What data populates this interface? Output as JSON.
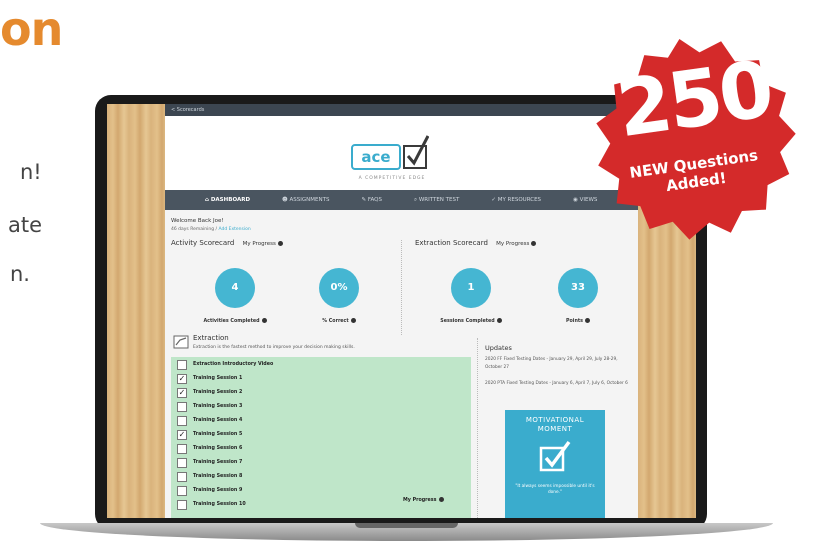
{
  "marketing": {
    "title": "on",
    "line1": "n!",
    "line2": "ate",
    "line3": "n."
  },
  "colors": {
    "accent": "#3aaccd",
    "orange": "#e58a2e",
    "seal_red": "#d42a2a",
    "green_panel": "#bfe6c9"
  },
  "app": {
    "topbar": "< Scorecards",
    "logo": {
      "text": "ace",
      "subtitle": "A COMPETITIVE EDGE"
    },
    "nav": [
      {
        "label": "DASHBOARD",
        "icon": "home-icon",
        "active": true
      },
      {
        "label": "ASSIGNMENTS",
        "icon": "users-icon",
        "active": false
      },
      {
        "label": "FAQS",
        "icon": "question-icon",
        "active": false
      },
      {
        "label": "WRITTEN TEST",
        "icon": "search-icon",
        "active": false
      },
      {
        "label": "MY RESOURCES",
        "icon": "check-icon",
        "active": false
      },
      {
        "label": "VIEWS",
        "icon": "eye-icon",
        "active": false
      }
    ],
    "welcome": "Welcome Back Joe!",
    "subinfo_text": "46 days Remaining",
    "subinfo_link": "Add Extension",
    "activity": {
      "title": "Activity Scorecard",
      "progress": "My Progress",
      "stats": [
        {
          "value": "4",
          "label": "Activities Completed"
        },
        {
          "value": "0%",
          "label": "% Correct"
        }
      ]
    },
    "extraction_card": {
      "title": "Extraction Scorecard",
      "progress": "My Progress",
      "stats": [
        {
          "value": "1",
          "label": "Sessions Completed"
        },
        {
          "value": "33",
          "label": "Points"
        }
      ]
    },
    "extraction": {
      "title": "Extraction",
      "description": "Extraction is the fastest method to improve your decision making skills.",
      "my_progress": "My Progress",
      "tasks": [
        {
          "label": "Extraction Introductory Video",
          "checked": false
        },
        {
          "label": "Training Session 1",
          "checked": true
        },
        {
          "label": "Training Session 2",
          "checked": true
        },
        {
          "label": "Training Session 3",
          "checked": false
        },
        {
          "label": "Training Session 4",
          "checked": false
        },
        {
          "label": "Training Session 5",
          "checked": true
        },
        {
          "label": "Training Session 6",
          "checked": false
        },
        {
          "label": "Training Session 7",
          "checked": false
        },
        {
          "label": "Training Session 8",
          "checked": false
        },
        {
          "label": "Training Session 9",
          "checked": false
        },
        {
          "label": "Training Session 10",
          "checked": false
        }
      ]
    },
    "updates": {
      "title": "Updates",
      "items": [
        "2020 FF Fixed Testing Dates - January 29, April 29, July 28-29, October 27",
        "2020 PTA Fixed Testing Dates - January 6, April 7, July 6, October 6"
      ]
    },
    "motivation": {
      "title_line1": "MOTIVATIONAL",
      "title_line2": "MOMENT",
      "quote": "\"It always seems impossible until it's done.\""
    }
  },
  "seal": {
    "number": "250",
    "line1": "NEW Questions",
    "line2": "Added!"
  }
}
